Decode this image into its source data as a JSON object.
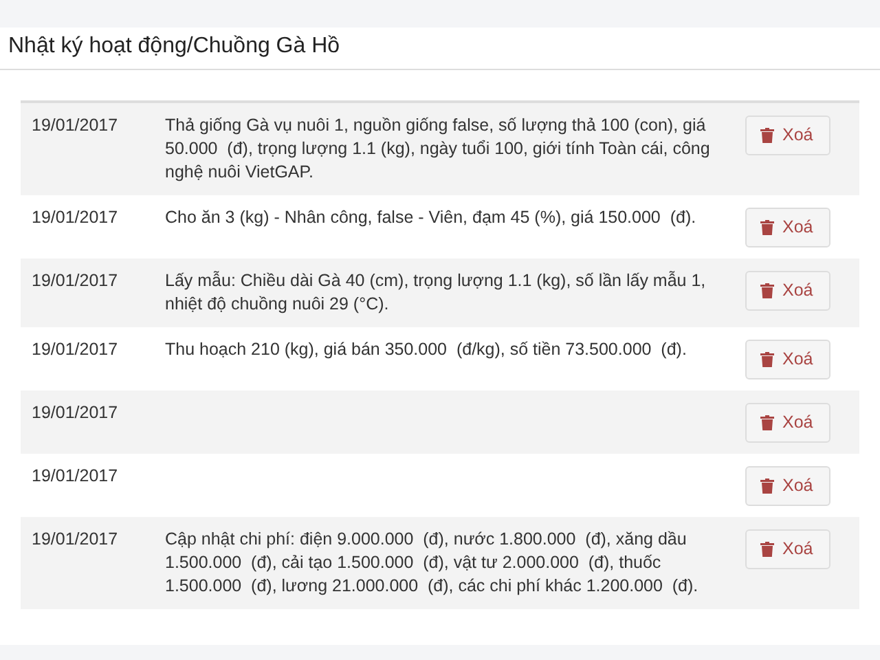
{
  "header": {
    "title": "Nhật ký hoạt động/Chuồng Gà Hồ"
  },
  "log": {
    "rows": [
      {
        "date": "19/01/2017",
        "description": "Thả giống Gà vụ nuôi 1, nguồn giống false, số lượng thả 100 (con), giá 50.000  (đ), trọng lượng 1.1 (kg), ngày tuổi 100, giới tính Toàn cái, công nghệ nuôi VietGAP.",
        "action": "Xoá"
      },
      {
        "date": "19/01/2017",
        "description": "Cho ăn 3 (kg) - Nhân công, false - Viên, đạm 45 (%), giá 150.000  (đ).",
        "action": "Xoá"
      },
      {
        "date": "19/01/2017",
        "description": "Lấy mẫu: Chiều dài Gà 40 (cm), trọng lượng 1.1 (kg), số lần lấy mẫu 1, nhiệt độ chuồng nuôi 29 (°C).",
        "action": "Xoá"
      },
      {
        "date": "19/01/2017",
        "description": "Thu hoạch 210 (kg), giá bán 350.000  (đ/kg), số tiền 73.500.000  (đ).",
        "action": "Xoá"
      },
      {
        "date": "19/01/2017",
        "action": "Xoá"
      },
      {
        "date": "19/01/2017",
        "action": "Xoá"
      },
      {
        "date": "19/01/2017",
        "description": "Cập nhật chi phí: điện 9.000.000  (đ), nước 1.800.000  (đ), xăng dầu 1.500.000  (đ), cải tạo 1.500.000  (đ), vật tư 2.000.000  (đ), thuốc 1.500.000  (đ), lương 21.000.000  (đ), các chi phí khác 1.200.000  (đ).",
        "action": "Xoá"
      }
    ]
  }
}
